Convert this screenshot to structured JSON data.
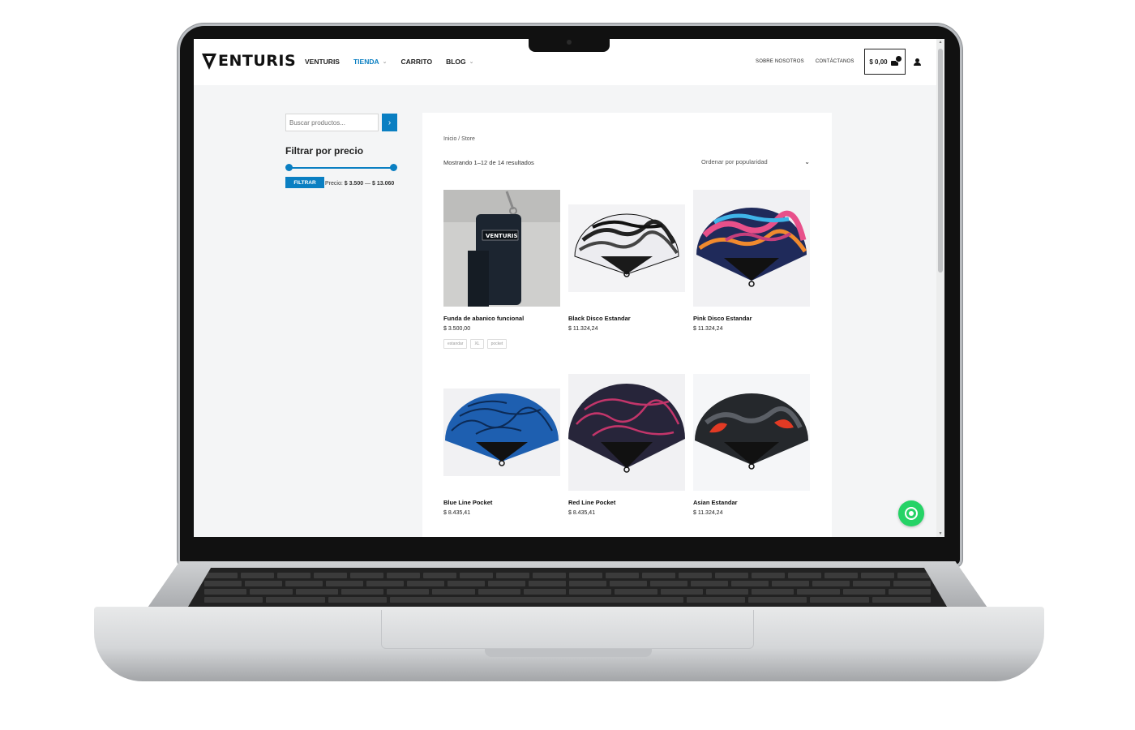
{
  "header": {
    "logo_text": "ENTURIS",
    "nav": [
      {
        "label": "VENTURIS",
        "has_dropdown": false,
        "active": false
      },
      {
        "label": "TIENDA",
        "has_dropdown": true,
        "active": true
      },
      {
        "label": "CARRITO",
        "has_dropdown": false,
        "active": false
      },
      {
        "label": "BLOG",
        "has_dropdown": true,
        "active": false
      }
    ],
    "secondary_nav": [
      "SOBRE NOSOTROS",
      "CONTÁCTANOS"
    ],
    "cart_total": "$ 0,00",
    "accent_color": "#0a7fc2"
  },
  "sidebar": {
    "search_placeholder": "Buscar productos...",
    "search_button_icon": "chevron-right-icon",
    "filter_title": "Filtrar por precio",
    "filter_button": "FILTRAR",
    "price_label": "Precio:",
    "price_min": "$ 3.500",
    "price_max": "$ 13.060"
  },
  "shop": {
    "breadcrumb": "Inicio / Store",
    "result_count": "Mostrando 1–12 de 14 resultados",
    "orderby": "Ordenar por popularidad",
    "products": [
      {
        "name": "Funda de abanico funcional",
        "price": "$ 3.500,00",
        "tags": [
          "estandar",
          "XL",
          "pocket"
        ],
        "image": "fan-case"
      },
      {
        "name": "Black Disco Estandar",
        "price": "$ 11.324,24",
        "tags": [],
        "image": "fan-black-white"
      },
      {
        "name": "Pink Disco Estandar",
        "price": "$ 11.324,24",
        "tags": [],
        "image": "fan-pink"
      },
      {
        "name": "Blue Line Pocket",
        "price": "$ 8.435,41",
        "tags": [],
        "image": "fan-blue"
      },
      {
        "name": "Red Line Pocket",
        "price": "$ 8.435,41",
        "tags": [],
        "image": "fan-red-line"
      },
      {
        "name": "Asian Estandar",
        "price": "$ 11.324,24",
        "tags": [],
        "image": "fan-koi"
      }
    ]
  },
  "floating": {
    "whatsapp_icon": "whatsapp-icon",
    "color": "#25d366"
  }
}
